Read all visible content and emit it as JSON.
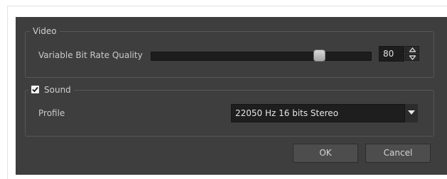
{
  "video": {
    "title": "Video",
    "bitrate_label": "Variable Bit Rate Quality",
    "bitrate_value": "80",
    "slider_position": 0.78
  },
  "sound": {
    "title": "Sound",
    "checked": true,
    "profile_label": "Profile",
    "profile_value": "22050 Hz 16 bits Stereo"
  },
  "buttons": {
    "ok": "OK",
    "cancel": "Cancel"
  },
  "icons": {
    "spin_up": "arrow-up-icon",
    "spin_down": "arrow-down-icon",
    "combo": "chevron-down-icon",
    "check": "checkmark-icon"
  },
  "colors": {
    "dialog_bg": "#3e3e3e",
    "field_bg": "#1e1e1e",
    "button_bg": "#4d4d4d"
  }
}
